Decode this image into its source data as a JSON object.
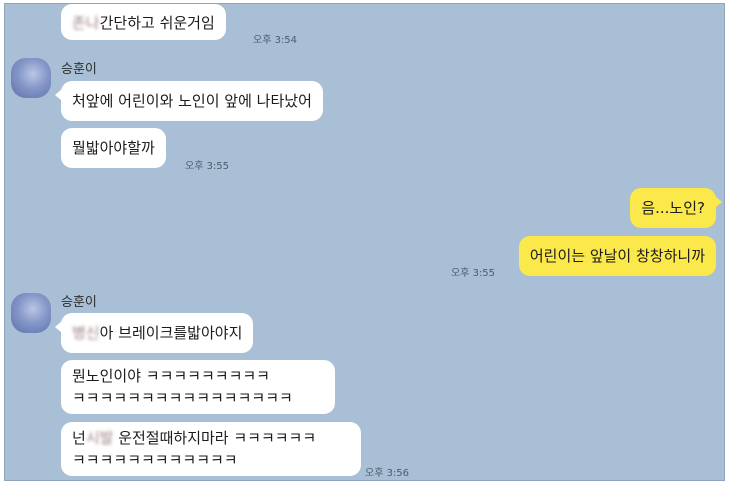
{
  "messages": [
    {
      "id": "m1",
      "prefix_blurred": "존나",
      "text": "간단하고 쉬운거임",
      "time": "오후 3:54"
    },
    {
      "id": "m2",
      "text": "처앞에 어린이와 노인이 앞에 나타났어"
    },
    {
      "id": "m3",
      "text": "뭘밟아야할까",
      "time": "오후 3:55"
    },
    {
      "id": "m4",
      "text": "음...노인?"
    },
    {
      "id": "m5",
      "text": "어린이는 앞날이 창창하니까",
      "time": "오후 3:55"
    },
    {
      "id": "m6",
      "prefix_blurred": "병신",
      "text": "아 브레이크를밟아야지"
    },
    {
      "id": "m7",
      "line1": "뭔노인이야 ㅋㅋㅋㅋㅋㅋㅋㅋㅋ",
      "line2": "ㅋㅋㅋㅋㅋㅋㅋㅋㅋㅋㅋㅋㅋㅋㅋㅋ"
    },
    {
      "id": "m8",
      "prefix": "넌",
      "blurred": "시발",
      "line1_rest": " 운전절때하지마라 ㅋㅋㅋㅋㅋㅋ",
      "line2": "ㅋㅋㅋㅋㅋㅋㅋㅋㅋㅋㅋㅋ",
      "time": "오후 3:56"
    }
  ],
  "senders": {
    "other": "승훈이"
  },
  "colors": {
    "background": "#a8bfd6",
    "my_bubble": "#fbe84a",
    "other_bubble": "#ffffff"
  }
}
